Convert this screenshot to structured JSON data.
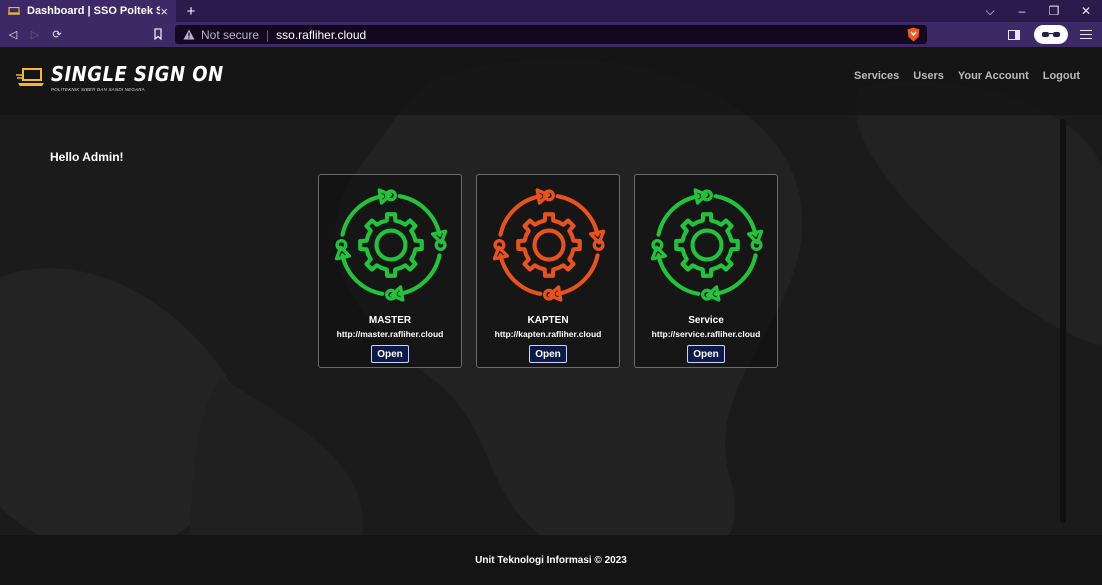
{
  "browser": {
    "tab_title": "Dashboard | SSO Poltek SSN",
    "tab_close": "×",
    "new_tab": "+",
    "security_label": "Not secure",
    "separator": "|",
    "url": "sso.rafliher.cloud",
    "window_controls": [
      "⌵",
      "–",
      "❐",
      "✕"
    ],
    "nav_buttons": [
      "◁",
      "▷",
      "⟳"
    ]
  },
  "site": {
    "logo_title": "SINGLE SIGN ON",
    "logo_subtitle": "POLITEKNIK SIBER DAN SANDI NEGARA",
    "nav": [
      "Services",
      "Users",
      "Your Account",
      "Logout"
    ]
  },
  "main": {
    "greeting": "Hello Admin!",
    "cards": [
      {
        "name": "MASTER",
        "url": "http://master.rafliher.cloud",
        "button": "Open",
        "color": "#22c33a"
      },
      {
        "name": "KAPTEN",
        "url": "http://kapten.rafliher.cloud",
        "button": "Open",
        "color": "#e8521c"
      },
      {
        "name": "Service",
        "url": "http://service.rafliher.cloud",
        "button": "Open",
        "color": "#22c33a"
      }
    ]
  },
  "footer": {
    "text": "Unit Teknologi Informasi © 2023"
  },
  "icons": {
    "favicon": "monitor-icon",
    "warning": "warning-icon",
    "shield": "brave-shield-icon",
    "card_icon": "gear-cycle-icon"
  }
}
